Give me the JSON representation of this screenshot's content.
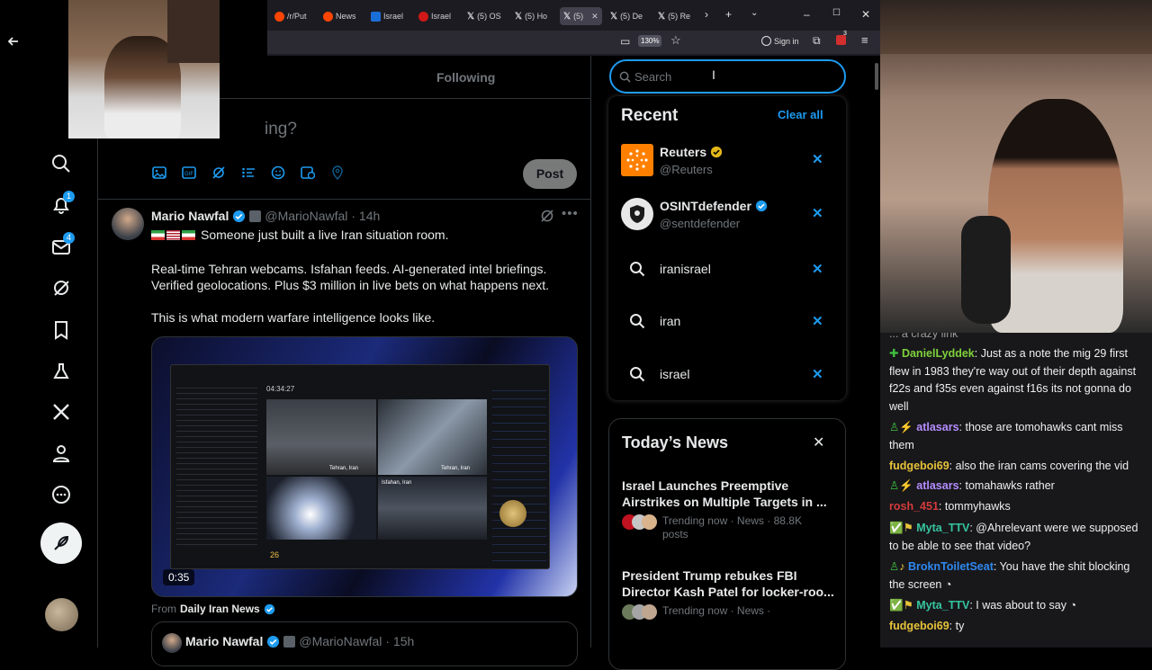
{
  "browser": {
    "tabs": [
      {
        "label": "/r/Put",
        "color": "#ff4500"
      },
      {
        "label": "News",
        "color": "#ff4500"
      },
      {
        "label": "Israel",
        "color": "#1a6fd6"
      },
      {
        "label": "Israel",
        "color": "#d01818"
      },
      {
        "label": "(5) OS",
        "color": "#ffffff"
      },
      {
        "label": "(5) Ho",
        "color": "#ffffff"
      },
      {
        "label": "(5)",
        "color": "#ffffff"
      },
      {
        "label": "(5) De",
        "color": "#ffffff"
      },
      {
        "label": "(5) Re",
        "color": "#ffffff"
      }
    ],
    "zoom": "130%",
    "sign_in": "Sign in",
    "ext_badge": "3"
  },
  "leftnav": {
    "notifications_badge": "1",
    "messages_badge": "4"
  },
  "center": {
    "tab_following": "Following",
    "compose_placeholder": "ing?",
    "post_button": "Post",
    "tweet": {
      "author": "Mario Nawfal",
      "handle": "@MarioNawfal",
      "time": "· 14h",
      "line1": "Someone just built a live Iran situation room.",
      "line2": "Real-time Tehran webcams. Isfahan feeds. AI-generated intel briefings.",
      "line3": "Verified geolocations. Plus $3 million in live bets on what happens next.",
      "line4": "This is what modern warfare intelligence looks like.",
      "video_duration": "0:35",
      "from_prefix": "From",
      "from_source": "Daily Iran News",
      "video_labels": {
        "cam1": "Tehran, Iran",
        "cam2": "Tehran, Iran",
        "cam3": "Isfahan, Iran",
        "time": "04:34:27",
        "value": "26"
      }
    },
    "quoted": {
      "author": "Mario Nawfal",
      "handle": "@MarioNawfal",
      "time": "· 15h"
    }
  },
  "search": {
    "placeholder": "Search",
    "recent_title": "Recent",
    "clear_all": "Clear all",
    "accounts": [
      {
        "name": "Reuters",
        "handle": "@Reuters"
      },
      {
        "name": "OSINTdefender",
        "handle": "@sentdefender"
      }
    ],
    "queries": [
      "iranisrael",
      "iran",
      "israel"
    ]
  },
  "news": {
    "title": "Today’s News",
    "items": [
      {
        "headline": "Israel Launches Preemptive Airstrikes on Multiple Targets in ...",
        "meta": "Trending now · News · 88.8K",
        "meta2": "posts"
      },
      {
        "headline": "President Trump rebukes FBI Director Kash Patel for locker-roo...",
        "meta": "Trending now · News ·",
        "meta2": ""
      }
    ]
  },
  "chat": {
    "top_fragment": "... a crazy link",
    "messages": [
      {
        "user": "DanielLyddek",
        "color": "#7fd13b",
        "text": ": Just as a note the mig 29 first flew in 1983 they're way out of their depth against f22s and f35s even against f16s its not gonna do well"
      },
      {
        "user": "atlasars",
        "color": "#b58dff",
        "text": ": those are tomohawks cant miss them"
      },
      {
        "user": "fudgeboi69",
        "color": "#e6c23a",
        "text": ": also the iran cams covering the vid"
      },
      {
        "user": "atlasars",
        "color": "#b58dff",
        "text": ": tomahawks rather"
      },
      {
        "user": "rosh_451",
        "color": "#d23b3b",
        "text": ": tommyhawks"
      },
      {
        "user": "Myta_TTV",
        "color": "#36c5a0",
        "text": ": @Ahrelevant were we supposed to be able to see that video?"
      },
      {
        "user": "BroknToiletSeat",
        "color": "#2f88f0",
        "text": ": You have the shit blocking the screen"
      },
      {
        "user": "Myta_TTV",
        "color": "#36c5a0",
        "text": ": I was about to say"
      },
      {
        "user": "fudgeboi69",
        "color": "#e6c23a",
        "text": ": ty"
      }
    ]
  }
}
